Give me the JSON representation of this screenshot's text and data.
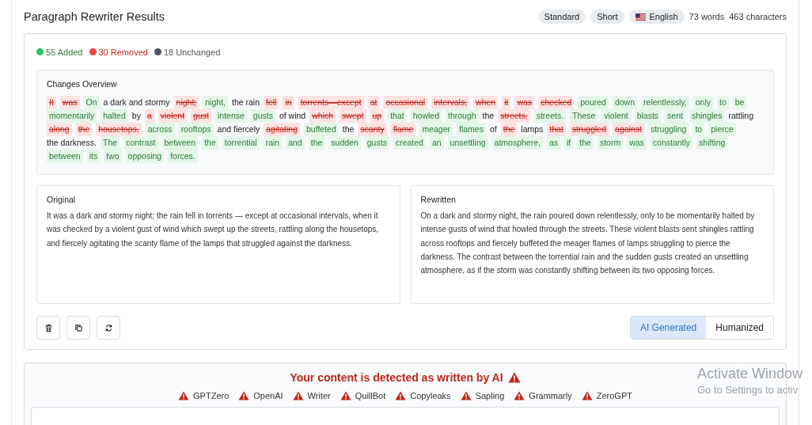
{
  "header": {
    "title": "Paragraph Rewriter Results",
    "badges": [
      {
        "kind": "plain",
        "label": "Standard"
      },
      {
        "kind": "plain",
        "label": "Short"
      },
      {
        "kind": "language",
        "label": "English"
      }
    ],
    "words": "73 words",
    "characters": "463 characters"
  },
  "legend": [
    {
      "kind": "added",
      "label": "55 Added",
      "color": "#22c55e"
    },
    {
      "kind": "removed",
      "label": "30 Removed",
      "color": "#ef4444"
    },
    {
      "kind": "unchanged",
      "label": "18 Unchanged",
      "color": "#4b5563"
    }
  ],
  "overview": {
    "title": "Changes Overview",
    "segments": [
      {
        "kind": "removed",
        "text": "It was"
      },
      {
        "kind": "added",
        "text": "On"
      },
      {
        "kind": "same",
        "text": "a dark and stormy"
      },
      {
        "kind": "removed",
        "text": "night;"
      },
      {
        "kind": "added",
        "text": "night,"
      },
      {
        "kind": "same",
        "text": "the rain"
      },
      {
        "kind": "removed",
        "text": "fell in torrents—except at occasional intervals, when it was checked"
      },
      {
        "kind": "added",
        "text": "poured down relentlessly, only to be momentarily halted"
      },
      {
        "kind": "same",
        "text": "by"
      },
      {
        "kind": "removed",
        "text": "a violent gust"
      },
      {
        "kind": "added",
        "text": "intense gusts"
      },
      {
        "kind": "same",
        "text": "of wind"
      },
      {
        "kind": "removed",
        "text": "which swept up"
      },
      {
        "kind": "added",
        "text": "that howled through"
      },
      {
        "kind": "same",
        "text": "the"
      },
      {
        "kind": "removed",
        "text": "streets,"
      },
      {
        "kind": "added",
        "text": "streets. These violent blasts sent shingles"
      },
      {
        "kind": "same",
        "text": "rattling"
      },
      {
        "kind": "removed",
        "text": "along the housetops,"
      },
      {
        "kind": "added",
        "text": "across rooftops"
      },
      {
        "kind": "same",
        "text": "and fiercely"
      },
      {
        "kind": "removed",
        "text": "agitating"
      },
      {
        "kind": "added",
        "text": "buffeted"
      },
      {
        "kind": "same",
        "text": "the"
      },
      {
        "kind": "removed",
        "text": "scanty flame"
      },
      {
        "kind": "added",
        "text": "meager flames"
      },
      {
        "kind": "same",
        "text": "of"
      },
      {
        "kind": "removed",
        "text": "the"
      },
      {
        "kind": "same",
        "text": "lamps"
      },
      {
        "kind": "removed",
        "text": "that struggled against"
      },
      {
        "kind": "added",
        "text": "struggling to pierce"
      },
      {
        "kind": "same",
        "text": "the darkness."
      },
      {
        "kind": "added",
        "text": "The contrast between the torrential rain and the sudden gusts created an unsettling atmosphere, as if the storm was constantly shifting between its two opposing forces."
      }
    ]
  },
  "original": {
    "title": "Original",
    "text": "It was a dark and stormy night; the rain fell in torrents — except at occasional intervals, when it was checked by a violent gust of wind which swept up the streets, rattling along the housetops, and fiercely agitating the scanty flame of the lamps that struggled against the darkness."
  },
  "rewritten": {
    "title": "Rewritten",
    "text": "On a dark and stormy night, the rain poured down relentlessly, only to be momentarily halted by intense gusts of wind that howled through the streets. These violent blasts sent shingles rattling across rooftops and fiercely buffeted the meager flames of lamps struggling to pierce the darkness. The contrast between the torrential rain and the sudden gusts created an unsettling atmosphere, as if the storm was constantly shifting between its two opposing forces."
  },
  "actions": [
    {
      "kind": "delete"
    },
    {
      "kind": "copy"
    },
    {
      "kind": "refresh"
    }
  ],
  "mode_tabs": [
    {
      "label": "AI Generated",
      "selected": true
    },
    {
      "label": "Humanized",
      "selected": false
    }
  ],
  "detection": {
    "headline": "Your content is detected as written by AI",
    "detectors": [
      "GPTZero",
      "OpenAI",
      "Writer",
      "QuillBot",
      "Copyleaks",
      "Sapling",
      "Grammarly",
      "ZeroGPT"
    ]
  },
  "os_notice": {
    "title": "Activate Window",
    "subtitle": "Go to Settings to activ"
  }
}
